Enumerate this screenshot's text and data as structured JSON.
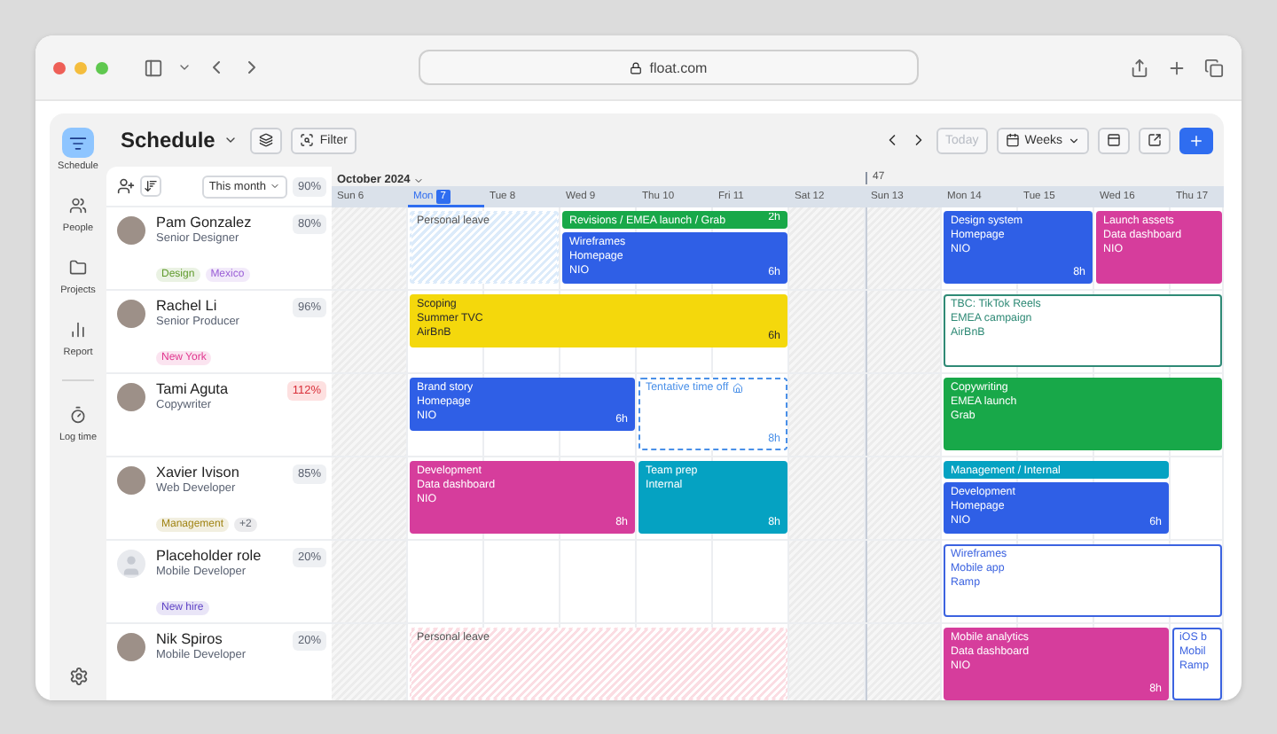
{
  "browser": {
    "url": "float.com"
  },
  "nav": {
    "items": [
      {
        "label": "Schedule",
        "selected": true
      },
      {
        "label": "People",
        "selected": false
      },
      {
        "label": "Projects",
        "selected": false
      },
      {
        "label": "Report",
        "selected": false
      },
      {
        "label": "Log time",
        "selected": false
      }
    ]
  },
  "toolbar": {
    "title": "Schedule",
    "filter_label": "Filter",
    "today_label": "Today",
    "today_disabled": true,
    "view_label": "Weeks"
  },
  "people_header": {
    "period": "This month",
    "total": "90%"
  },
  "calendar": {
    "month": "October 2024",
    "days": [
      {
        "weekday": "Sun",
        "date": "6",
        "weekend": true,
        "today": false
      },
      {
        "weekday": "Mon",
        "date": "7",
        "weekend": false,
        "today": true
      },
      {
        "weekday": "Tue",
        "date": "8",
        "weekend": false,
        "today": false
      },
      {
        "weekday": "Wed",
        "date": "9",
        "weekend": false,
        "today": false
      },
      {
        "weekday": "Thu",
        "date": "10",
        "weekend": false,
        "today": false
      },
      {
        "weekday": "Fri",
        "date": "11",
        "weekend": false,
        "today": false
      },
      {
        "weekday": "Sat",
        "date": "12",
        "weekend": true,
        "today": false
      },
      {
        "weekday": "Sun",
        "date": "13",
        "weekend": true,
        "today": false,
        "week_number": "47"
      },
      {
        "weekday": "Mon",
        "date": "14",
        "weekend": false,
        "today": false
      },
      {
        "weekday": "Tue",
        "date": "15",
        "weekend": false,
        "today": false
      },
      {
        "weekday": "Wed",
        "date": "16",
        "weekend": false,
        "today": false
      },
      {
        "weekday": "Thu",
        "date": "17",
        "weekend": false,
        "today": false
      }
    ]
  },
  "people": [
    {
      "name": "Pam Gonzalez",
      "role": "Senior Designer",
      "utilization": "80%",
      "over": false,
      "avatar_placeholder": false,
      "tags": [
        {
          "label": "Design",
          "color": "#5f9a2c"
        },
        {
          "label": "Mexico",
          "color": "#9a5fd6"
        }
      ],
      "events": [
        {
          "kind": "leave",
          "title": "Personal leave",
          "color": "#dcebfa"
        },
        {
          "kind": "solid",
          "title": "Revisions / EMEA launch / Grab",
          "hours": "2h",
          "color": "#18a849"
        },
        {
          "kind": "solid",
          "title": "Wireframes",
          "lines": [
            "Homepage",
            "NIO"
          ],
          "hours": "6h",
          "color": "#2f5fe6"
        },
        {
          "kind": "solid",
          "title": "Design system",
          "lines": [
            "Homepage",
            "NIO"
          ],
          "hours": "8h",
          "color": "#2f5fe6"
        },
        {
          "kind": "solid",
          "title": "Launch assets",
          "lines": [
            "Data dashboard",
            "NIO"
          ],
          "color": "#d63d9c"
        }
      ]
    },
    {
      "name": "Rachel Li",
      "role": "Senior Producer",
      "utilization": "96%",
      "over": false,
      "avatar_placeholder": false,
      "tags": [
        {
          "label": "New York",
          "color": "#e0358e"
        }
      ],
      "events": [
        {
          "kind": "solid",
          "title": "Scoping",
          "lines": [
            "Summer TVC",
            "AirBnB"
          ],
          "hours": "6h",
          "color": "#f4d80c"
        },
        {
          "kind": "outline",
          "title": "TBC: TikTok Reels",
          "lines": [
            "EMEA campaign",
            "AirBnB"
          ],
          "color": "#2f8a76"
        }
      ]
    },
    {
      "name": "Tami Aguta",
      "role": "Copywriter",
      "utilization": "112%",
      "over": true,
      "avatar_placeholder": false,
      "events": [
        {
          "kind": "solid",
          "title": "Brand story",
          "lines": [
            "Homepage",
            "NIO"
          ],
          "hours": "6h",
          "color": "#2f5fe6"
        },
        {
          "kind": "tentative",
          "title": "Tentative time off",
          "hours": "8h",
          "color": "#4a90e8"
        },
        {
          "kind": "solid",
          "title": "Copywriting",
          "lines": [
            "EMEA launch",
            "Grab"
          ],
          "color": "#18a849"
        }
      ]
    },
    {
      "name": "Xavier Ivison",
      "role": "Web Developer",
      "utilization": "85%",
      "over": false,
      "avatar_placeholder": false,
      "tags": [
        {
          "label": "Management",
          "color": "#a08414"
        },
        {
          "label": "+2",
          "color": "#666b75"
        }
      ],
      "events": [
        {
          "kind": "solid",
          "title": "Development",
          "lines": [
            "Data dashboard",
            "NIO"
          ],
          "hours": "8h",
          "color": "#d63d9c"
        },
        {
          "kind": "solid",
          "title": "Team prep",
          "lines": [
            "Internal"
          ],
          "hours": "8h",
          "color": "#05a2c2"
        },
        {
          "kind": "solid",
          "title": "Management / Internal",
          "color": "#05a2c2"
        },
        {
          "kind": "solid",
          "title": "Development",
          "lines": [
            "Homepage",
            "NIO"
          ],
          "hours": "6h",
          "color": "#2f5fe6"
        }
      ]
    },
    {
      "name": "Placeholder role",
      "role": "Mobile Developer",
      "utilization": "20%",
      "over": false,
      "avatar_placeholder": true,
      "tags": [
        {
          "label": "New hire",
          "color": "#5b3fc4"
        }
      ],
      "events": [
        {
          "kind": "outline",
          "title": "Wireframes",
          "lines": [
            "Mobile app",
            "Ramp"
          ],
          "color": "#3c63e0"
        }
      ]
    },
    {
      "name": "Nik Spiros",
      "role": "Mobile Developer",
      "utilization": "20%",
      "over": false,
      "avatar_placeholder": false,
      "events": [
        {
          "kind": "leave",
          "title": "Personal leave",
          "color": "#fbdde3"
        },
        {
          "kind": "solid",
          "title": "Mobile analytics",
          "lines": [
            "Data dashboard",
            "NIO"
          ],
          "hours": "8h",
          "color": "#d63d9c"
        },
        {
          "kind": "outline",
          "title": "iOS b",
          "lines": [
            "Mobil",
            "Ramp"
          ],
          "color": "#3c63e0"
        }
      ]
    }
  ]
}
